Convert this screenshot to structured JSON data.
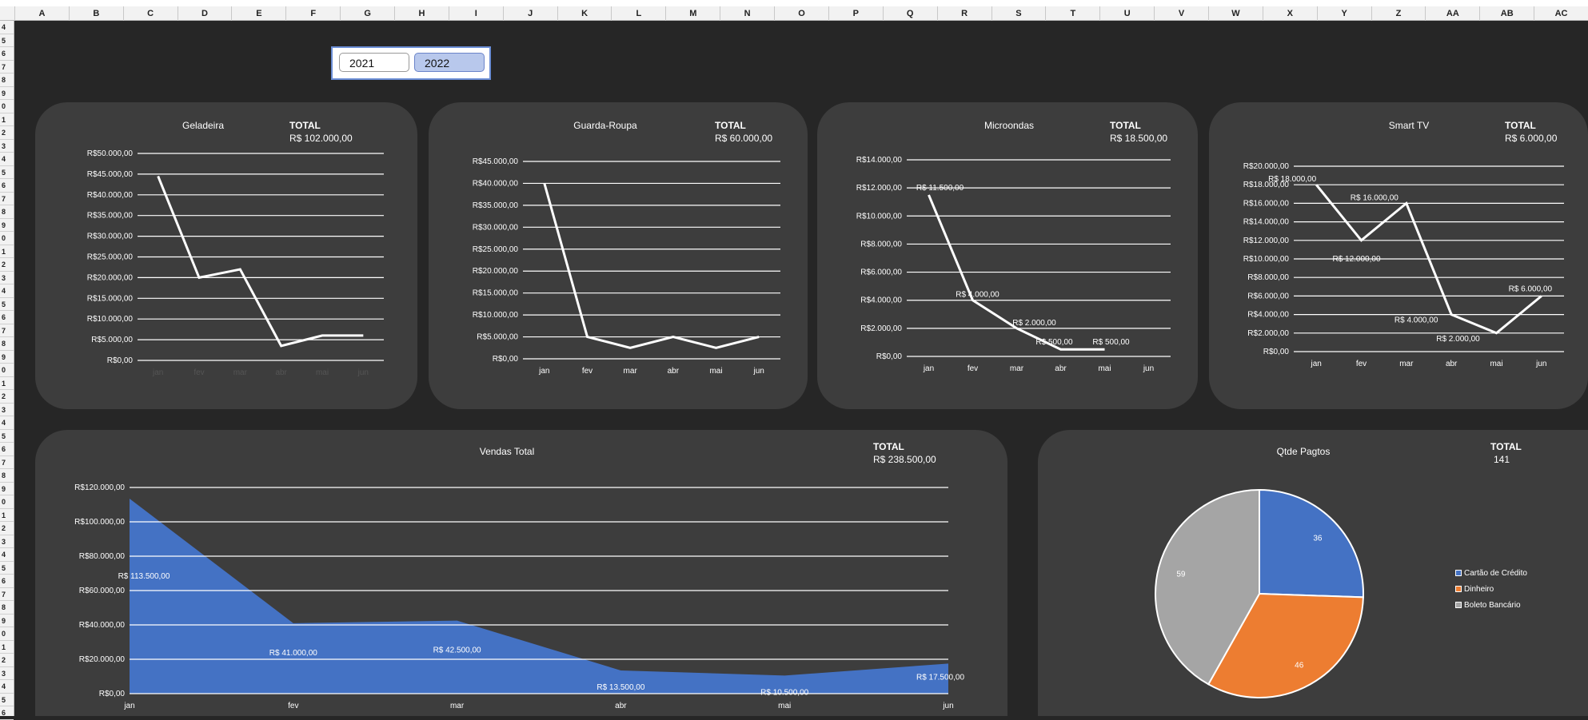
{
  "spreadsheet": {
    "columns": [
      "A",
      "B",
      "C",
      "D",
      "E",
      "F",
      "G",
      "H",
      "I",
      "J",
      "K",
      "L",
      "M",
      "N",
      "O",
      "P",
      "Q",
      "R",
      "S",
      "T",
      "U",
      "V",
      "W",
      "X",
      "Y",
      "Z",
      "AA",
      "AB",
      "AC"
    ],
    "rows": [
      "4",
      "5",
      "6",
      "7",
      "8",
      "9",
      "0",
      "1",
      "2",
      "3",
      "4",
      "5",
      "6",
      "7",
      "8",
      "9",
      "0",
      "1",
      "2",
      "3",
      "4",
      "5",
      "6",
      "7",
      "8",
      "9",
      "0",
      "1",
      "2",
      "3",
      "4",
      "5",
      "6",
      "7",
      "8",
      "9",
      "0",
      "1",
      "2",
      "3",
      "4",
      "5",
      "6",
      "7",
      "8",
      "9",
      "0",
      "1",
      "2",
      "3",
      "4",
      "5",
      "6"
    ]
  },
  "slicer": {
    "options": [
      "2021",
      "2022"
    ],
    "selected": "2022"
  },
  "colors": {
    "background": "#262626",
    "panel": "#3d3d3d",
    "line": "#ffffff",
    "area": "#4472c4",
    "pie_blue": "#4472c4",
    "pie_orange": "#ed7d31",
    "pie_gray": "#a5a5a5"
  },
  "charts": [
    {
      "title": "Geladeira",
      "total_label": "TOTAL",
      "total_value": "R$ 102.000,00",
      "chart_data": {
        "type": "line",
        "x": [
          "jan",
          "fev",
          "mar",
          "abr",
          "mai",
          "jun"
        ],
        "values": [
          44500,
          20000,
          22000,
          3500,
          6000,
          6000
        ],
        "ylim": [
          0,
          50000
        ],
        "ytick_labels": [
          "R$0,00",
          "R$5.000,00",
          "R$10.000,00",
          "R$15.000,00",
          "R$20.000,00",
          "R$25.000,00",
          "R$30.000,00",
          "R$35.000,00",
          "R$40.000,00",
          "R$45.000,00",
          "R$50.000,00"
        ],
        "data_labels": [],
        "grid": true
      }
    },
    {
      "title": "Guarda-Roupa",
      "total_label": "TOTAL",
      "total_value": "R$ 60.000,00",
      "chart_data": {
        "type": "line",
        "x": [
          "jan",
          "fev",
          "mar",
          "abr",
          "mai",
          "jun"
        ],
        "values": [
          40000,
          5000,
          2500,
          5000,
          2500,
          5000
        ],
        "ylim": [
          0,
          45000
        ],
        "ytick_labels": [
          "R$0,00",
          "R$5.000,00",
          "R$10.000,00",
          "R$15.000,00",
          "R$20.000,00",
          "R$25.000,00",
          "R$30.000,00",
          "R$35.000,00",
          "R$40.000,00",
          "R$45.000,00"
        ],
        "data_labels": [],
        "grid": true
      }
    },
    {
      "title": "Microondas",
      "total_label": "TOTAL",
      "total_value": "R$ 18.500,00",
      "chart_data": {
        "type": "line",
        "x": [
          "jan",
          "fev",
          "mar",
          "abr",
          "mai",
          "jun"
        ],
        "values": [
          11500,
          4000,
          2000,
          500,
          500
        ],
        "ylim": [
          0,
          14000
        ],
        "ytick_labels": [
          "R$0,00",
          "R$2.000,00",
          "R$4.000,00",
          "R$6.000,00",
          "R$8.000,00",
          "R$10.000,00",
          "R$12.000,00",
          "R$14.000,00"
        ],
        "data_labels": [
          "R$ 11.500,00",
          "R$ 4.000,00",
          "R$ 2.000,00",
          "R$ 500,00",
          "R$ 500,00"
        ],
        "grid": true
      }
    },
    {
      "title": "Smart TV",
      "total_label": "TOTAL",
      "total_value": "R$ 6.000,00",
      "chart_data": {
        "type": "line",
        "x": [
          "jan",
          "fev",
          "mar",
          "abr",
          "mai",
          "jun"
        ],
        "values": [
          18000,
          12000,
          16000,
          4000,
          2000,
          6000
        ],
        "ylim": [
          0,
          20000
        ],
        "ytick_labels": [
          "R$0,00",
          "R$2.000,00",
          "R$4.000,00",
          "R$6.000,00",
          "R$8.000,00",
          "R$10.000,00",
          "R$12.000,00",
          "R$14.000,00",
          "R$16.000,00",
          "R$18.000,00",
          "R$20.000,00"
        ],
        "data_labels": [
          "R$ 18.000,00",
          "R$ 12.000,00",
          "R$ 16.000,00",
          "R$ 4.000,00",
          "R$ 2.000,00",
          "R$ 6.000,00"
        ],
        "grid": true
      }
    },
    {
      "title": "Vendas Total",
      "total_label": "TOTAL",
      "total_value": "R$ 238.500,00",
      "chart_data": {
        "type": "area",
        "x": [
          "jan",
          "fev",
          "mar",
          "abr",
          "mai",
          "jun"
        ],
        "values": [
          113500,
          41000,
          42500,
          13500,
          10500,
          17500
        ],
        "ylim": [
          0,
          120000
        ],
        "ytick_labels": [
          "R$0,00",
          "R$20.000,00",
          "R$40.000,00",
          "R$60.000,00",
          "R$80.000,00",
          "R$100.000,00",
          "R$120.000,00"
        ],
        "data_labels": [
          "R$ 113.500,00",
          "R$ 41.000,00",
          "R$ 42.500,00",
          "R$ 13.500,00",
          "R$ 10.500,00",
          "R$ 17.500,00"
        ],
        "grid": true
      }
    },
    {
      "title": "Qtde Pagtos",
      "total_label": "TOTAL",
      "total_value": "141",
      "chart_data": {
        "type": "pie",
        "categories": [
          "Cartão de Crédito",
          "Dinheiro",
          "Boleto Bancário"
        ],
        "values": [
          36,
          46,
          59
        ],
        "colors": [
          "#4472c4",
          "#ed7d31",
          "#a5a5a5"
        ],
        "data_labels": [
          "36",
          "46",
          "59"
        ],
        "legend": "right"
      }
    }
  ]
}
